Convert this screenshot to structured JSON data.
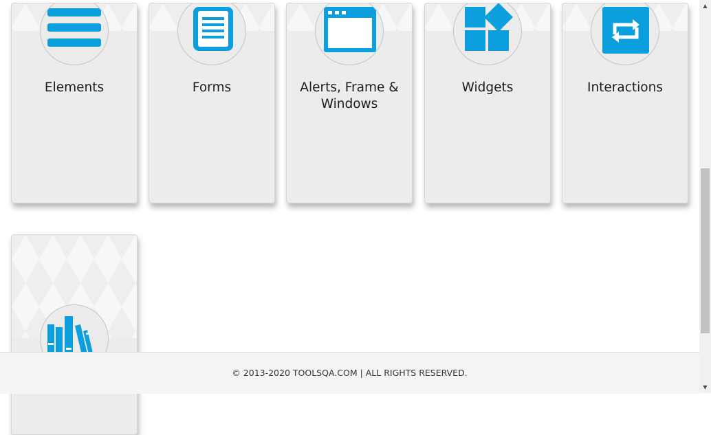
{
  "cards": [
    {
      "title": "Elements",
      "icon": "hamburger-list-icon"
    },
    {
      "title": "Forms",
      "icon": "document-form-icon"
    },
    {
      "title": "Alerts, Frame & Windows",
      "icon": "browser-window-icon"
    },
    {
      "title": "Widgets",
      "icon": "widgets-blocks-icon"
    },
    {
      "title": "Interactions",
      "icon": "repeat-arrows-icon"
    },
    {
      "title": "",
      "icon": "bookshelf-icon"
    }
  ],
  "footer": {
    "text": "© 2013-2020 TOOLSQA.COM | ALL RIGHTS RESERVED."
  },
  "colors": {
    "accent": "#0c9fdd",
    "card_bg": "#ececec",
    "footer_bg": "#f5f5f5"
  }
}
